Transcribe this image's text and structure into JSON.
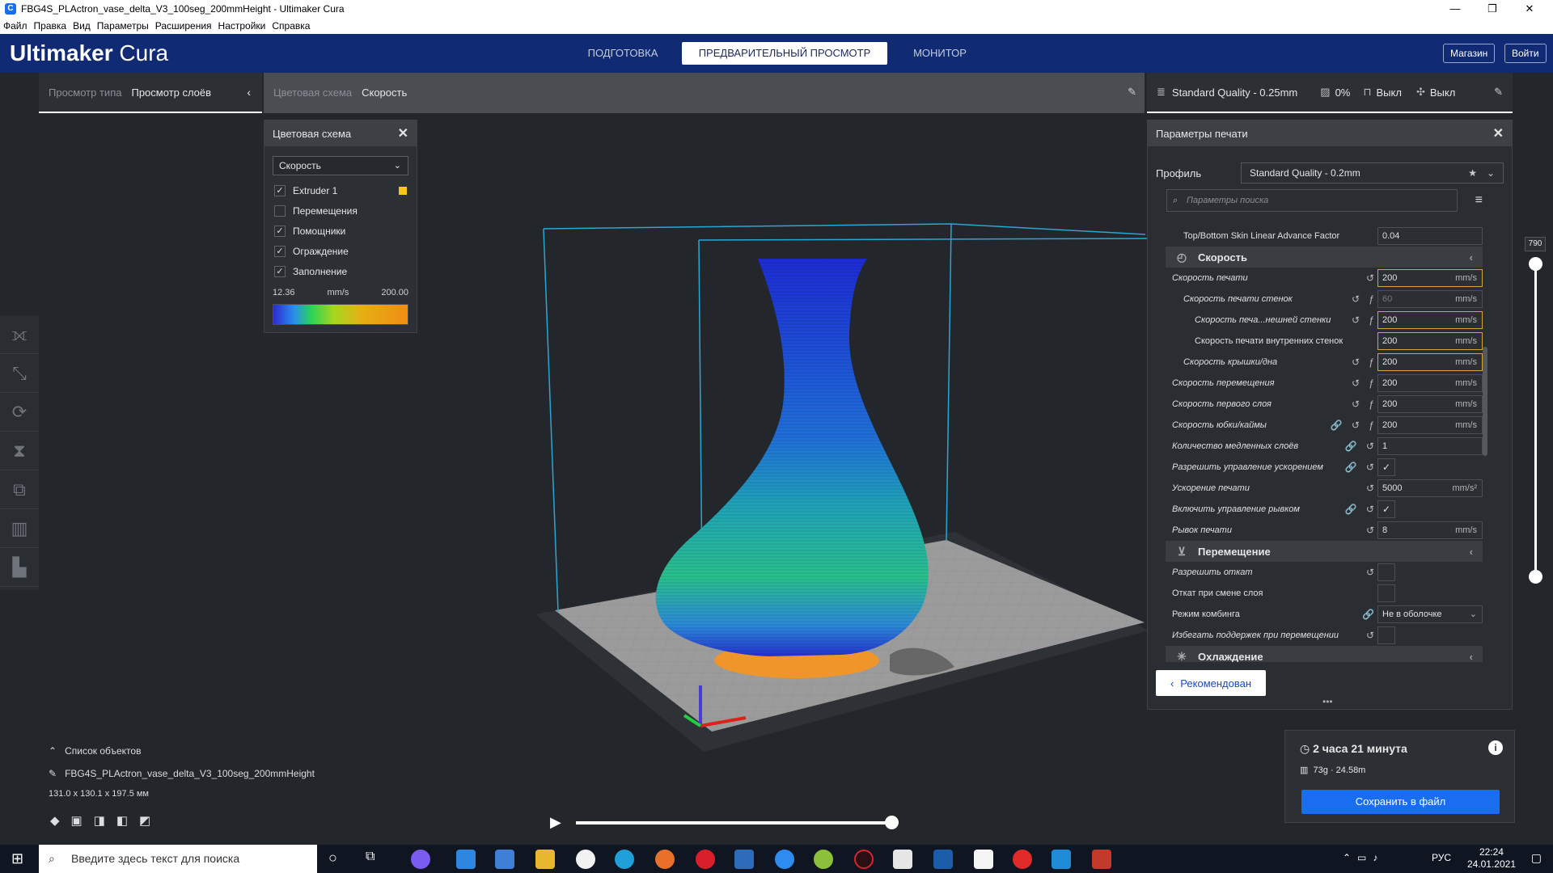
{
  "window": {
    "title": "FBG4S_PLActron_vase_delta_V3_100seg_200mmHeight - Ultimaker Cura",
    "minimize": "—",
    "maximize": "❐",
    "close": "✕"
  },
  "menu": [
    "Файл",
    "Правка",
    "Вид",
    "Параметры",
    "Расширения",
    "Настройки",
    "Справка"
  ],
  "header": {
    "logo_main": "Ultimaker",
    "logo_sub": "Cura",
    "tabs": [
      "ПОДГОТОВКА",
      "ПРЕДВАРИТЕЛЬНЫЙ ПРОСМОТР",
      "МОНИТОР"
    ],
    "active_tab": "ПРЕДВАРИТЕЛЬНЫЙ ПРОСМОТР",
    "store": "Магазин",
    "login": "Войти"
  },
  "view_bar": {
    "label": "Просмотр типа",
    "value": "Просмотр слоёв"
  },
  "color_bar": {
    "label": "Цветовая схема",
    "value": "Скорость"
  },
  "quality_bar": {
    "profile": "Standard Quality - 0.25mm",
    "infill": "0%",
    "support": "Выкл",
    "adhesion": "Выкл"
  },
  "color_panel": {
    "title": "Цветовая схема",
    "select": "Скорость",
    "items": [
      {
        "label": "Extruder 1",
        "checked": true,
        "swatch": "#f5c518"
      },
      {
        "label": "Перемещения",
        "checked": false
      },
      {
        "label": "Помощники",
        "checked": true
      },
      {
        "label": "Ограждение",
        "checked": true
      },
      {
        "label": "Заполнение",
        "checked": true
      }
    ],
    "range_min": "12.36",
    "range_unit": "mm/s",
    "range_max": "200.00"
  },
  "settings_panel": {
    "title": "Параметры печати",
    "profile_label": "Профиль",
    "profile_value": "Standard Quality - 0.2mm",
    "search_placeholder": "Параметры поиска",
    "recommended": "Рекомендован"
  },
  "settings_rows": [
    {
      "type": "row",
      "label": "Top/Bottom Skin Linear Advance Factor",
      "value": "0.04",
      "indent": 1,
      "italic": false
    },
    {
      "type": "cat",
      "label": "Скорость",
      "icon": "speed-icon"
    },
    {
      "type": "row",
      "label": "Скорость печати",
      "value": "200",
      "unit": "mm/s",
      "indent": 0,
      "hl": true,
      "icons": "↺"
    },
    {
      "type": "row",
      "label": "Скорость печати стенок",
      "value": "60",
      "unit": "mm/s",
      "indent": 1,
      "dis": true,
      "icons": "↺ ƒ"
    },
    {
      "type": "row",
      "label": "Скорость печа...нешней стенки",
      "value": "200",
      "unit": "mm/s",
      "indent": 2,
      "hl": true,
      "icons": "↺ ƒ"
    },
    {
      "type": "row",
      "label": "Скорость печати внутренних стенок",
      "value": "200",
      "unit": "mm/s",
      "indent": 2,
      "hl": true,
      "italic": false
    },
    {
      "type": "row",
      "label": "Скорость крышки/дна",
      "value": "200",
      "unit": "mm/s",
      "indent": 1,
      "hl": true,
      "icons": "↺ ƒ"
    },
    {
      "type": "row",
      "label": "Скорость перемещения",
      "value": "200",
      "unit": "mm/s",
      "indent": 0,
      "icons": "↺ ƒ"
    },
    {
      "type": "row",
      "label": "Скорость первого слоя",
      "value": "200",
      "unit": "mm/s",
      "indent": 0,
      "icons": "↺ ƒ"
    },
    {
      "type": "row",
      "label": "Скорость юбки/каймы",
      "value": "200",
      "unit": "mm/s",
      "indent": 0,
      "icons": "🔗 ↺ ƒ"
    },
    {
      "type": "row",
      "label": "Количество медленных слоёв",
      "value": "1",
      "unit": "",
      "indent": 0,
      "icons": "🔗 ↺"
    },
    {
      "type": "check",
      "label": "Разрешить управление ускорением",
      "checked": true,
      "indent": 0,
      "icons": "🔗 ↺"
    },
    {
      "type": "row",
      "label": "Ускорение печати",
      "value": "5000",
      "unit": "mm/s²",
      "indent": 0,
      "icons": "↺"
    },
    {
      "type": "check",
      "label": "Включить управление рывком",
      "checked": true,
      "indent": 0,
      "icons": "🔗 ↺"
    },
    {
      "type": "row",
      "label": "Рывок печати",
      "value": "8",
      "unit": "mm/s",
      "indent": 0,
      "icons": "↺"
    },
    {
      "type": "cat",
      "label": "Перемещение",
      "icon": "travel-icon"
    },
    {
      "type": "check",
      "label": "Разрешить откат",
      "checked": false,
      "indent": 0,
      "icons": "↺"
    },
    {
      "type": "check",
      "label": "Откат при смене слоя",
      "checked": false,
      "indent": 0,
      "italic": false
    },
    {
      "type": "select",
      "label": "Режим комбинга",
      "value": "Не в оболочке",
      "indent": 0,
      "icons": "🔗",
      "italic": false
    },
    {
      "type": "check",
      "label": "Избегать поддержек при перемещении",
      "checked": false,
      "indent": 0,
      "icons": "↺"
    },
    {
      "type": "cat",
      "label": "Охлаждение",
      "icon": "cooling-icon"
    }
  ],
  "layer_slider": {
    "value": "790"
  },
  "object_list": {
    "title": "Список объектов",
    "file": "FBG4S_PLActron_vase_delta_V3_100seg_200mmHeight",
    "dimensions": "131.0 x 130.1 x 197.5 мм"
  },
  "print_info": {
    "time": "2 часа 21 минута",
    "material": "73g · 24.58m",
    "save": "Сохранить в файл"
  },
  "taskbar": {
    "search_placeholder": "Введите здесь текст для поиска",
    "lang": "РУС",
    "time": "22:24",
    "date": "24.01.2021"
  }
}
